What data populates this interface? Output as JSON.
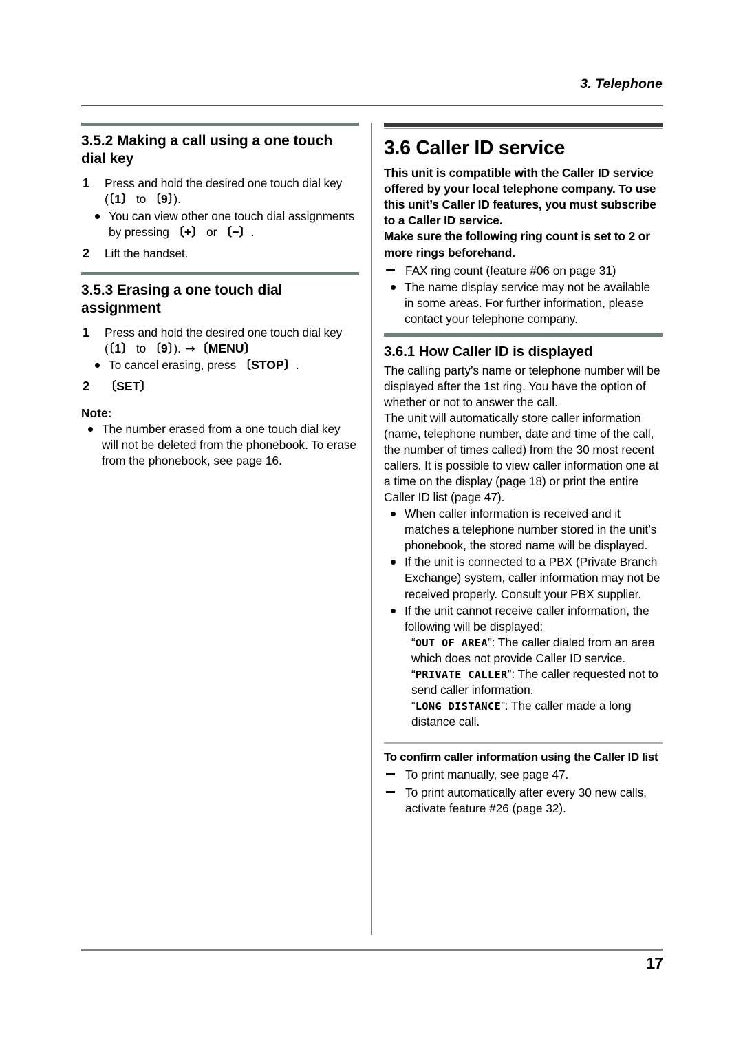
{
  "header": {
    "chapter_title": "3. Telephone"
  },
  "footer": {
    "page_number": "17"
  },
  "left_column": {
    "section_352": {
      "heading": "3.5.2 Making a call using a one touch dial key",
      "step1_num": "1",
      "step1_a": "Press and hold the desired one touch dial key (",
      "step1_key_1": "1",
      "step1_b": " to ",
      "step1_key_9": "9",
      "step1_c": ").",
      "step1_bullet_a": "You can view other one touch dial assignments by pressing ",
      "step1_bullet_key_plus": "+",
      "step1_bullet_or": " or ",
      "step1_bullet_key_minus": "−",
      "step1_bullet_c": ".",
      "step2_num": "2",
      "step2_text": "Lift the handset."
    },
    "section_353": {
      "heading": "3.5.3 Erasing a one touch dial assignment",
      "step1_num": "1",
      "step1_a": "Press and hold the desired one touch dial key (",
      "step1_key_1": "1",
      "step1_b": " to ",
      "step1_key_9": "9",
      "step1_c": "). ",
      "step1_arrow": "→",
      "step1_key_menu": "MENU",
      "step1_bullet_a": "To cancel erasing, press ",
      "step1_bullet_key_stop": "STOP",
      "step1_bullet_c": ".",
      "step2_num": "2",
      "step2_key_set": "SET",
      "note_label": "Note:",
      "note_bullet": "The number erased from a one touch dial key will not be deleted from the phonebook. To erase from the phonebook, see page 16."
    }
  },
  "right_column": {
    "section_36": {
      "heading": "3.6 Caller ID service",
      "lead_paragraph_1": "This unit is compatible with the Caller ID service offered by your local telephone company. To use this unit’s Caller ID features, you must subscribe to a Caller ID service.",
      "lead_paragraph_2": "Make sure the following ring count is set to 2 or more rings beforehand.",
      "dash_1": "FAX ring count (feature #06 on page 31)",
      "bullet_1": "The name display service may not be available in some areas. For further information, please contact your telephone company."
    },
    "section_361": {
      "heading": "3.6.1 How Caller ID is displayed",
      "paragraph_1": "The calling party’s name or telephone number will be displayed after the 1st ring. You have the option of whether or not to answer the call.",
      "paragraph_2": "The unit will automatically store caller information (name, telephone number, date and time of the call, the number of times called) from the 30 most recent callers. It is possible to view caller information one at a time on the display (page 18) or print the entire Caller ID list (page 47).",
      "bullet_1": "When caller information is received and it matches a telephone number stored in the unit’s phonebook, the stored name will be displayed.",
      "bullet_2": "If the unit is connected to a PBX (Private Branch Exchange) system, caller information may not be received properly. Consult your PBX supplier.",
      "bullet_3": "If the unit cannot receive caller information, the following will be displayed:",
      "display_1_open": "“",
      "display_1_lcd": "OUT OF AREA",
      "display_1_close": "”",
      "display_1_text": ": The caller dialed from an area which does not provide Caller ID service.",
      "display_2_lcd": "PRIVATE CALLER",
      "display_2_text": ": The caller requested not to send caller information.",
      "display_3_lcd": "LONG DISTANCE",
      "display_3_text": ": The caller made a long distance call."
    },
    "confirm_block": {
      "heading": "To confirm caller information using the Caller ID list",
      "dash_1": "To print manually, see page 47.",
      "dash_2": "To print automatically after every 30 new calls, activate feature #26 (page 32)."
    }
  },
  "colors": {
    "rule_green": "#6f807c",
    "rule_dark": "#3b3b3b",
    "rule_thin": "#a8b2ad",
    "divider_gray": "#7b7f7e",
    "footer_rule": "#808080"
  }
}
